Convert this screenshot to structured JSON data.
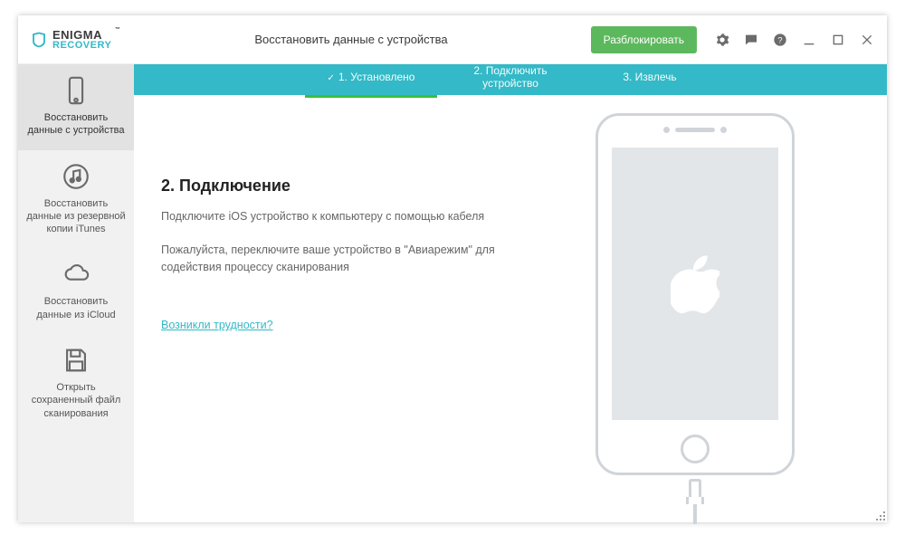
{
  "brand": {
    "top": "ENIGMA",
    "bottom": "RECOVERY",
    "tm": "™"
  },
  "titlebar": {
    "title": "Восстановить данные с устройства",
    "unlock": "Разблокировать"
  },
  "sidebar": {
    "items": [
      {
        "label": "Восстановить данные с устройства"
      },
      {
        "label": "Восстановить данные из резервной копии iTunes"
      },
      {
        "label": "Восстановить данные из iCloud"
      },
      {
        "label": "Открыть сохраненный файл сканирования"
      }
    ]
  },
  "steps": [
    {
      "label": "1. Установлено",
      "state": "done"
    },
    {
      "label": "2. Подключить устройство",
      "state": "active"
    },
    {
      "label": "3. Извлечь",
      "state": "pending"
    }
  ],
  "content": {
    "heading": "2. Подключение",
    "line1": "Подключите iOS устройство к компьютеру с помощью кабеля",
    "line2": "Пожалуйста, переключите ваше устройство в \"Авиарежим\" для содействия процессу сканирования",
    "help_link": "Возникли трудности?"
  }
}
